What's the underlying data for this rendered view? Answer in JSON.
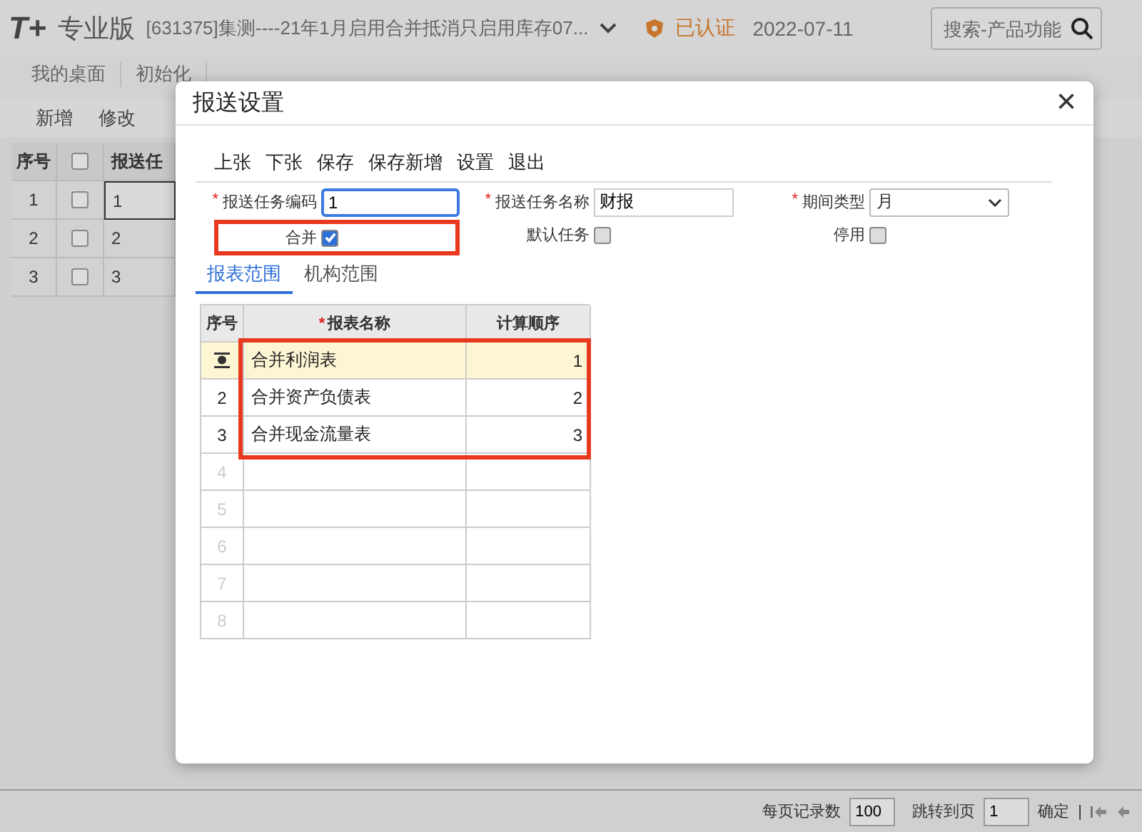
{
  "header": {
    "logo": "T+",
    "edition": "专业版",
    "account": "[631375]集测----21年1月启用合并抵消只启用库存07...",
    "certified": "已认证",
    "date": "2022-07-11",
    "search": {
      "placeholder": "搜索-产品功能"
    }
  },
  "nav_tabs": [
    "我的桌面",
    "初始化"
  ],
  "toolbar": [
    "新增",
    "修改"
  ],
  "grid": {
    "columns": [
      "序号",
      "报送任"
    ],
    "header_checked": false,
    "rows": [
      {
        "index": "1",
        "checked": false,
        "code": "1",
        "selected": true
      },
      {
        "index": "2",
        "checked": false,
        "code": "2",
        "selected": false
      },
      {
        "index": "3",
        "checked": false,
        "code": "3",
        "selected": false
      }
    ]
  },
  "dialog": {
    "title": "报送设置",
    "close": "×",
    "toolbar": [
      "上张",
      "下张",
      "保存",
      "保存新增",
      "设置",
      "退出"
    ],
    "fields": [
      {
        "kind": "text",
        "marker": "*",
        "label": "报送任务编码",
        "value": "1",
        "focused": true
      },
      {
        "kind": "text",
        "marker": "*",
        "label": "报送任务名称",
        "value": "财报",
        "focused": false
      },
      {
        "kind": "select",
        "marker": "*",
        "label": "期间类型",
        "value": "月"
      },
      {
        "kind": "checkbox",
        "label": "合并",
        "checked": true,
        "highlighted": true
      },
      {
        "kind": "checkbox",
        "label": "默认任务",
        "checked": false,
        "highlighted": false
      },
      {
        "kind": "checkbox",
        "label": "停用",
        "checked": false,
        "highlighted": false
      }
    ],
    "tabs": [
      {
        "label": "报表范围",
        "selected": true
      },
      {
        "label": "机构范围",
        "selected": false
      }
    ],
    "table": {
      "columns": [
        {
          "label": "序号"
        },
        {
          "marker": "*",
          "label": "报表名称"
        },
        {
          "label": "计算顺序"
        }
      ],
      "rows": [
        {
          "name": "合并利润表",
          "order": "1",
          "selected": true,
          "highlighted": true
        },
        {
          "index": "2",
          "name": "合并资产负债表",
          "order": "2",
          "selected": false,
          "highlighted": true
        },
        {
          "index": "3",
          "name": "合并现金流量表",
          "order": "3",
          "selected": false,
          "highlighted": true
        },
        {
          "index": "4"
        },
        {
          "index": "5"
        },
        {
          "index": "6"
        },
        {
          "index": "7"
        },
        {
          "index": "8"
        }
      ]
    }
  },
  "footer": {
    "page_size_label": "每页记录数",
    "page_size": "100",
    "goto_label": "跳转到页",
    "goto_page": "1",
    "confirm": "确定",
    "separator": "|"
  }
}
